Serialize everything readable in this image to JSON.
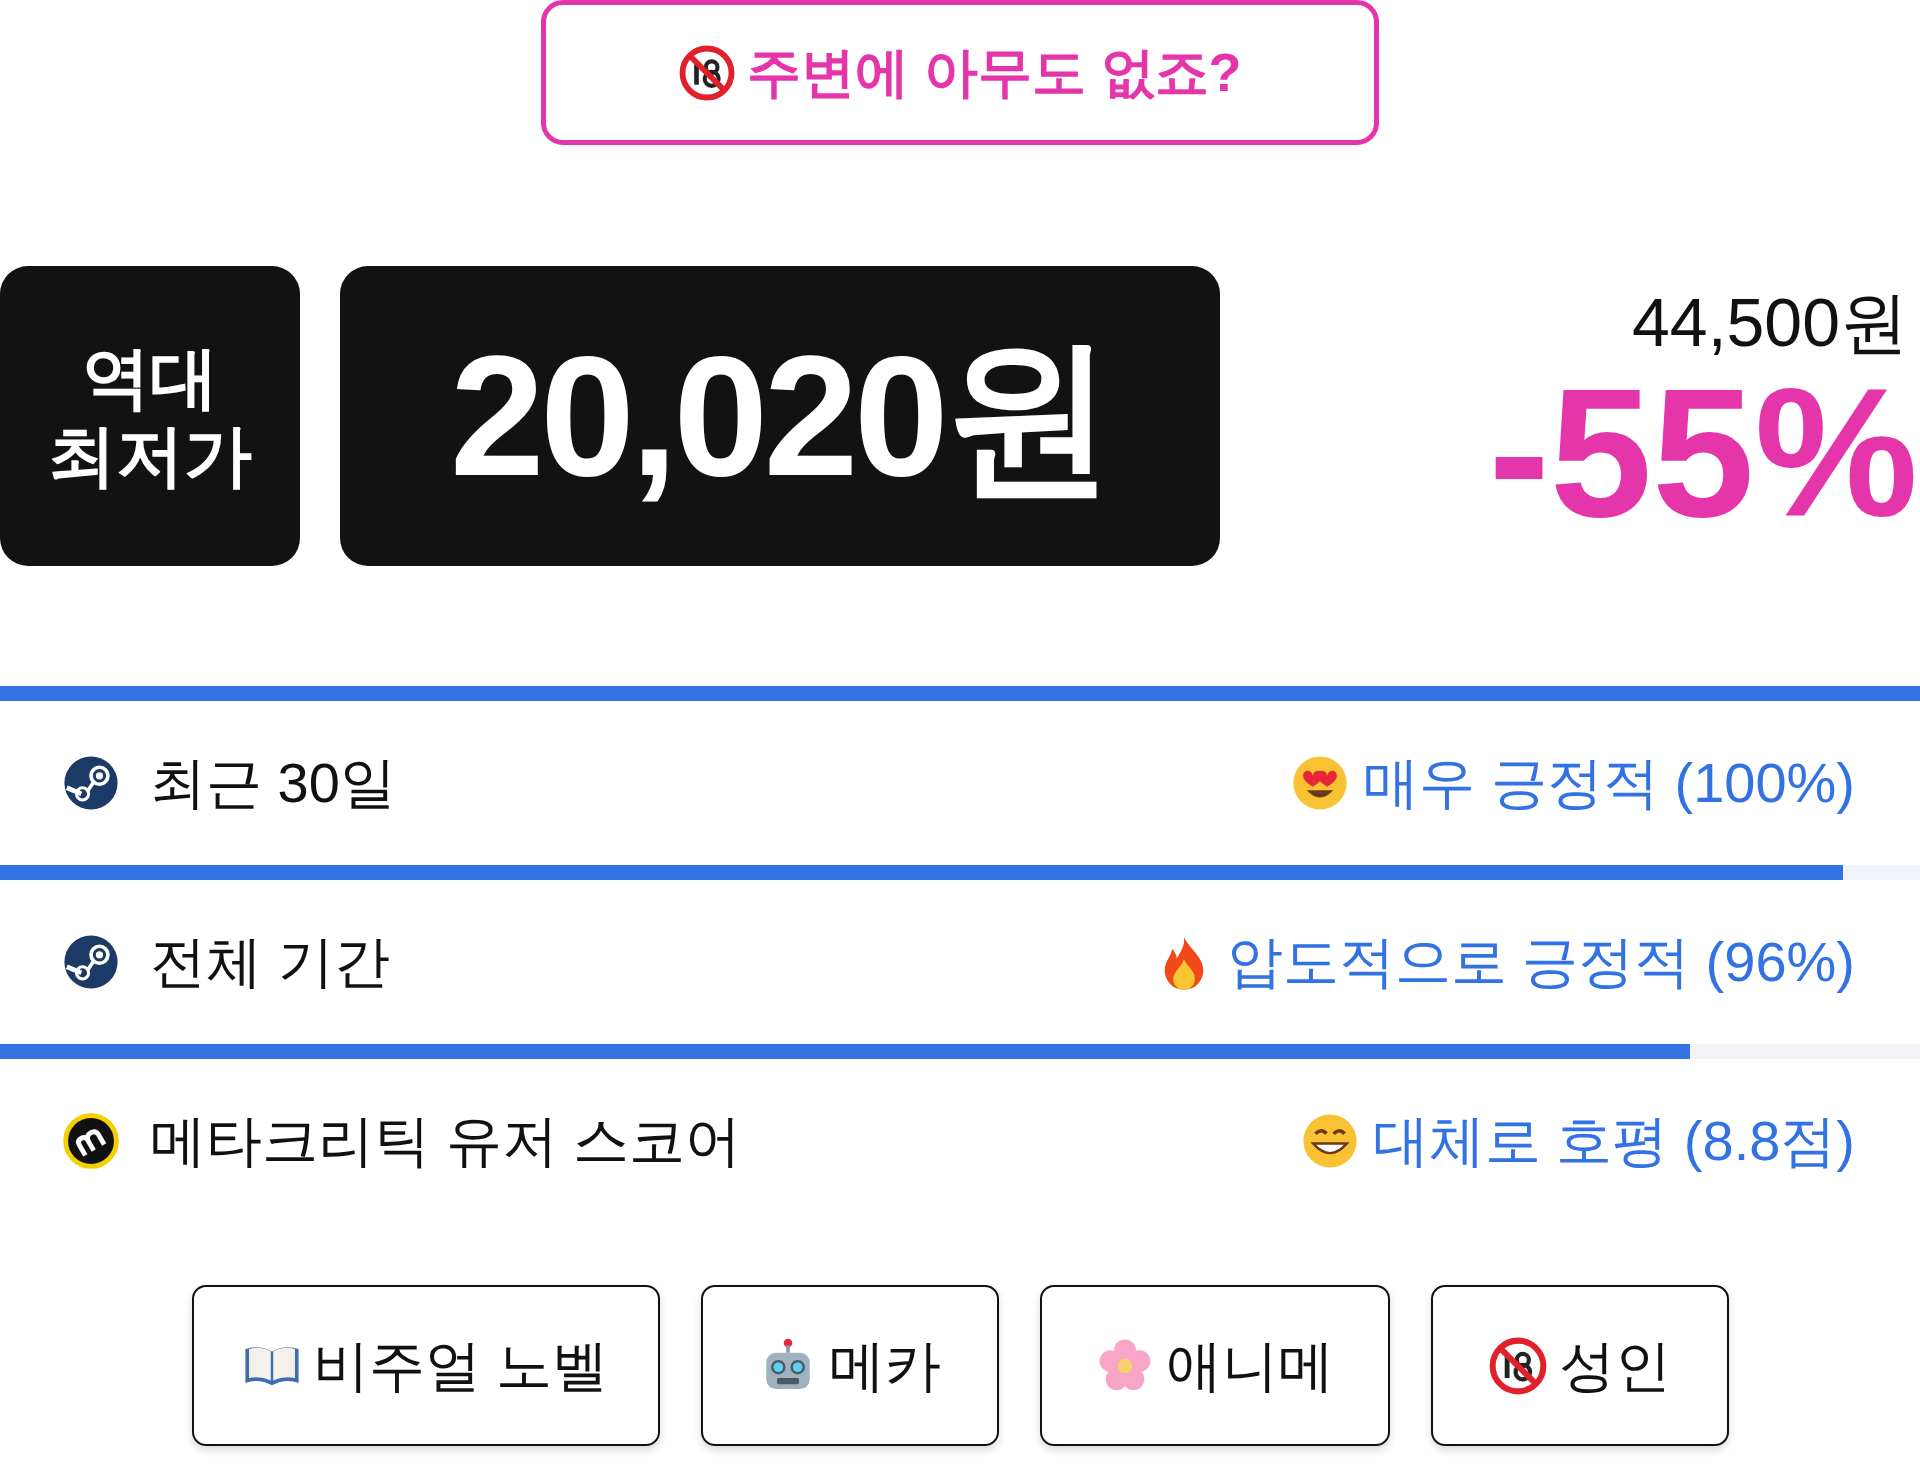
{
  "warning_button": {
    "label": "주변에 아무도 없죠?"
  },
  "price": {
    "badge_lines": [
      "역대",
      "최저가"
    ],
    "current": "20,020원",
    "original": "44,500원",
    "discount": "-55%"
  },
  "reviews": [
    {
      "level": 1,
      "label": "최근 30일",
      "rating": "매우 긍정적 (100%)"
    },
    {
      "level": 0.96,
      "label": "전체 기간",
      "rating": "압도적으로 긍정적 (96%)"
    },
    {
      "level": 0.88,
      "label": "메타크리틱 유저 스코어",
      "rating": "대체로 호평 (8.8점)"
    }
  ],
  "tags": [
    {
      "label": "비주얼 노벨"
    },
    {
      "label": "메카"
    },
    {
      "label": "애니메"
    },
    {
      "label": "성인"
    }
  ]
}
